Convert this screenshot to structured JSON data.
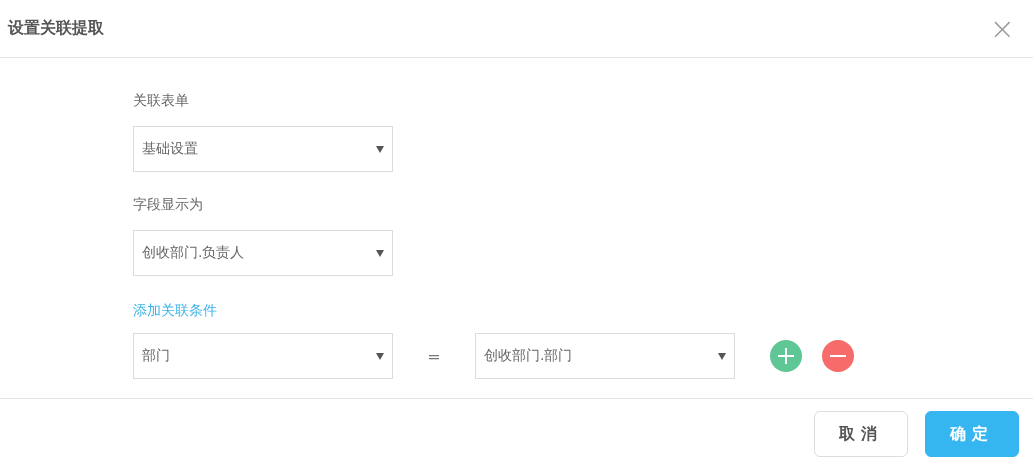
{
  "dialog": {
    "title": "设置关联提取",
    "close": "×"
  },
  "fields": [
    {
      "label": "关联表单",
      "value": "基础设置"
    },
    {
      "label": "字段显示为",
      "value": "创收部门.负责人"
    }
  ],
  "conditions": {
    "link": "添加关联条件",
    "rows": [
      {
        "left": "部门",
        "operator": "=",
        "right": "创收部门.部门"
      }
    ]
  },
  "buttons": [
    {
      "label": "取消",
      "kind": "secondary"
    },
    {
      "label": "确定",
      "kind": "primary"
    }
  ]
}
